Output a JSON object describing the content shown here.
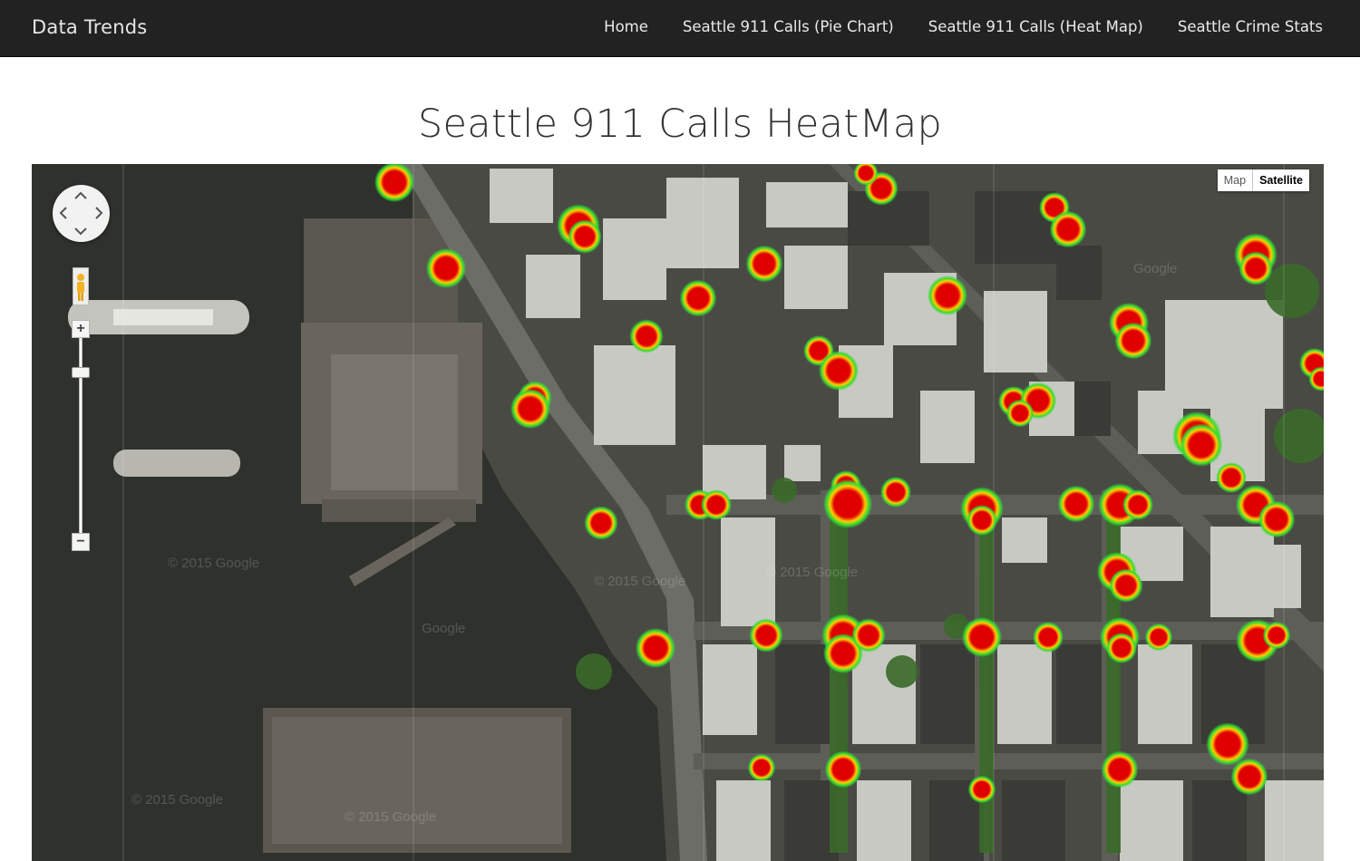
{
  "navbar": {
    "brand": "Data Trends",
    "links": [
      {
        "label": "Home"
      },
      {
        "label": "Seattle 911 Calls (Pie Chart)"
      },
      {
        "label": "Seattle 911 Calls (Heat Map)"
      },
      {
        "label": "Seattle Crime Stats"
      }
    ]
  },
  "page": {
    "title": "Seattle 911 Calls HeatMap"
  },
  "map": {
    "view": "satellite",
    "map_type_buttons": [
      {
        "label": "Map",
        "active": false
      },
      {
        "label": "Satellite",
        "active": true
      }
    ],
    "zoom_in_label": "+",
    "zoom_out_label": "−",
    "watermarks": [
      "© 2015 Google",
      "Google"
    ],
    "heat_colors": {
      "hot": "#e10000",
      "mid": "#ffcc00",
      "cool": "#33dd33"
    },
    "colors": {
      "water": "#2f312c",
      "land": "#4a4a44",
      "road": "#6d6d68",
      "roof_light": "#c9c9c3",
      "roof_dark": "#3a3a36",
      "trees": "#3a6a2a",
      "pier": "#6a655c"
    }
  }
}
